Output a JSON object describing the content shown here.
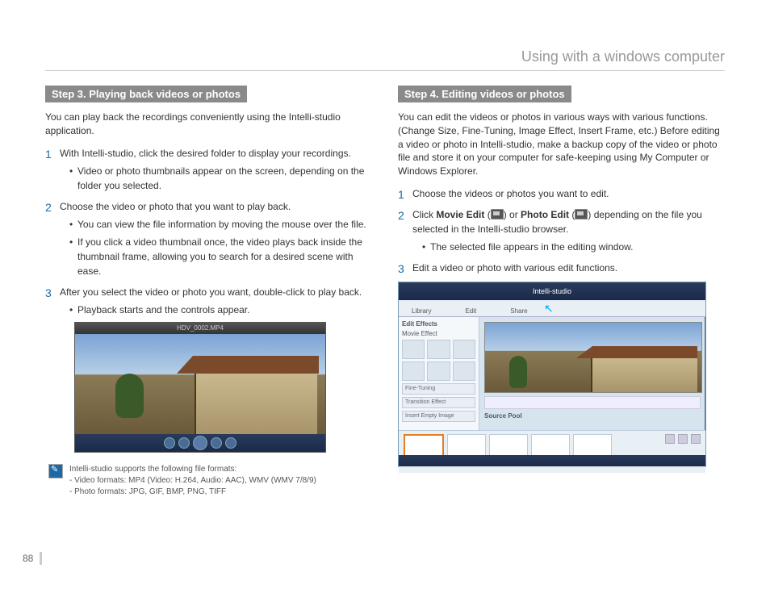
{
  "page_title": "Using with a windows computer",
  "page_number": "88",
  "left": {
    "step_header": "Step 3. Playing back videos or photos",
    "intro": "You can play back the recordings conveniently using the Intelli-studio application.",
    "items": [
      {
        "num": "1",
        "text": "With Intelli-studio, click the desired folder to display your recordings.",
        "subs": [
          "Video or photo thumbnails appear on the screen, depending on the folder you selected."
        ]
      },
      {
        "num": "2",
        "text": "Choose the video or photo that you want to play back.",
        "subs": [
          "You can view the file information by moving the mouse over the file.",
          "If you click a video thumbnail once, the video plays back inside the thumbnail frame, allowing you to search for a desired scene with ease."
        ]
      },
      {
        "num": "3",
        "text": "After you select the video or photo you want, double-click to play back.",
        "subs": [
          "Playback starts and the controls appear."
        ]
      }
    ],
    "player_title": "HDV_0002.MP4",
    "note_lines": [
      "Intelli-studio supports the following file formats:",
      "- Video formats: MP4 (Video: H.264, Audio: AAC), WMV (WMV 7/8/9)",
      "- Photo formats: JPG, GIF, BMP, PNG, TIFF"
    ]
  },
  "right": {
    "step_header": "Step 4. Editing videos or photos",
    "intro": "You can edit the videos or photos in various ways with various functions. (Change Size, Fine-Tuning, Image Effect, Insert Frame, etc.) Before editing a video or photo in Intelli-studio, make a backup copy of the video or photo file and store it on your computer for safe-keeping using My Computer or Windows Explorer.",
    "items": [
      {
        "num": "1",
        "text_plain": "Choose the videos or photos you want to edit.",
        "subs": []
      },
      {
        "num": "2",
        "prefix": "Click ",
        "bold1": "Movie Edit",
        "mid1": " (",
        "mid2": ") or ",
        "bold2": "Photo Edit",
        "mid3": " (",
        "suffix": ") depending on the file you selected in the Intelli-studio browser.",
        "subs": [
          "The selected file appears in the editing window."
        ]
      },
      {
        "num": "3",
        "text_plain": "Edit a video or photo with various edit functions.",
        "subs": []
      }
    ],
    "editor_title": "Intelli-studio",
    "side_header": "Edit Effects",
    "side_sub": "Movie Effect",
    "side_rows": [
      "Fine-Tuning",
      "Transition Effect",
      "Insert Empty Image"
    ],
    "src_label": "Source Pool"
  }
}
